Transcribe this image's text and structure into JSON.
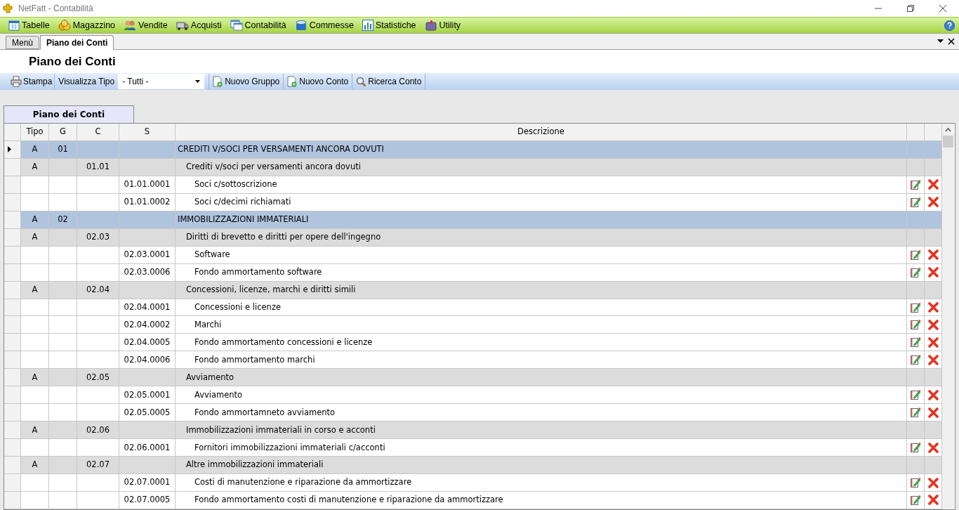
{
  "window": {
    "title": "NetFatt - Contabilità"
  },
  "menu": [
    {
      "label": "Tabelle"
    },
    {
      "label": "Magazzino"
    },
    {
      "label": "Vendite"
    },
    {
      "label": "Acquisti"
    },
    {
      "label": "Contabilità"
    },
    {
      "label": "Commesse"
    },
    {
      "label": "Statistiche"
    },
    {
      "label": "Utility"
    }
  ],
  "tabs": [
    {
      "label": "Menù",
      "selected": false
    },
    {
      "label": "Piano dei Conti",
      "selected": true
    }
  ],
  "page_title": "Piano dei Conti",
  "toolbar": {
    "print": "Stampa",
    "filter_label": "Visualizza Tipo",
    "filter_value": "- Tutti -",
    "new_group": "Nuovo Gruppo",
    "new_account": "Nuovo Conto",
    "search": "Ricerca Conto"
  },
  "grid_tab": "Piano dei Conti",
  "table": {
    "columns": [
      "Tipo",
      "G",
      "C",
      "S",
      "Descrizione"
    ],
    "rows": [
      {
        "kind": "group",
        "selected": true,
        "tipo": "A",
        "g": "01",
        "c": "",
        "s": "",
        "descrizione": "CREDITI V/SOCI PER VERSAMENTI ANCORA DOVUTI"
      },
      {
        "kind": "account",
        "selected": false,
        "tipo": "A",
        "g": "",
        "c": "01.01",
        "s": "",
        "descrizione": "Crediti v/soci per versamenti ancora dovuti"
      },
      {
        "kind": "sub",
        "selected": false,
        "tipo": "",
        "g": "",
        "c": "",
        "s": "01.01.0001",
        "descrizione": "Soci c/sottoscrizione"
      },
      {
        "kind": "sub",
        "selected": false,
        "tipo": "",
        "g": "",
        "c": "",
        "s": "01.01.0002",
        "descrizione": "Soci c/decimi richiamati"
      },
      {
        "kind": "group",
        "selected": false,
        "tipo": "A",
        "g": "02",
        "c": "",
        "s": "",
        "descrizione": "IMMOBILIZZAZIONI IMMATERIALI"
      },
      {
        "kind": "account",
        "selected": false,
        "tipo": "A",
        "g": "",
        "c": "02.03",
        "s": "",
        "descrizione": "Diritti di brevetto e diritti per opere dell'ingegno"
      },
      {
        "kind": "sub",
        "selected": false,
        "tipo": "",
        "g": "",
        "c": "",
        "s": "02.03.0001",
        "descrizione": "Software"
      },
      {
        "kind": "sub",
        "selected": false,
        "tipo": "",
        "g": "",
        "c": "",
        "s": "02.03.0006",
        "descrizione": "Fondo ammortamento software"
      },
      {
        "kind": "account",
        "selected": false,
        "tipo": "A",
        "g": "",
        "c": "02.04",
        "s": "",
        "descrizione": "Concessioni, licenze, marchi e diritti simili"
      },
      {
        "kind": "sub",
        "selected": false,
        "tipo": "",
        "g": "",
        "c": "",
        "s": "02.04.0001",
        "descrizione": "Concessioni e licenze"
      },
      {
        "kind": "sub",
        "selected": false,
        "tipo": "",
        "g": "",
        "c": "",
        "s": "02.04.0002",
        "descrizione": "Marchi"
      },
      {
        "kind": "sub",
        "selected": false,
        "tipo": "",
        "g": "",
        "c": "",
        "s": "02.04.0005",
        "descrizione": "Fondo ammortamento concessioni e licenze"
      },
      {
        "kind": "sub",
        "selected": false,
        "tipo": "",
        "g": "",
        "c": "",
        "s": "02.04.0006",
        "descrizione": "Fondo ammortamento marchi"
      },
      {
        "kind": "account",
        "selected": false,
        "tipo": "A",
        "g": "",
        "c": "02.05",
        "s": "",
        "descrizione": "Avviamento"
      },
      {
        "kind": "sub",
        "selected": false,
        "tipo": "",
        "g": "",
        "c": "",
        "s": "02.05.0001",
        "descrizione": "Avviamento"
      },
      {
        "kind": "sub",
        "selected": false,
        "tipo": "",
        "g": "",
        "c": "",
        "s": "02.05.0005",
        "descrizione": "Fondo ammortamneto avviamento"
      },
      {
        "kind": "account",
        "selected": false,
        "tipo": "A",
        "g": "",
        "c": "02.06",
        "s": "",
        "descrizione": "Immobilizzazioni immateriali in corso e acconti"
      },
      {
        "kind": "sub",
        "selected": false,
        "tipo": "",
        "g": "",
        "c": "",
        "s": "02.06.0001",
        "descrizione": "Fornitori immobilizzazioni immateriali c/acconti"
      },
      {
        "kind": "account",
        "selected": false,
        "tipo": "A",
        "g": "",
        "c": "02.07",
        "s": "",
        "descrizione": "Altre immobilizzazioni immateriali"
      },
      {
        "kind": "sub",
        "selected": false,
        "tipo": "",
        "g": "",
        "c": "",
        "s": "02.07.0001",
        "descrizione": "Costi di manutenzione e riparazione da ammortizzare"
      },
      {
        "kind": "sub",
        "selected": false,
        "tipo": "",
        "g": "",
        "c": "",
        "s": "02.07.0005",
        "descrizione": "Fondo ammortamento costi di manutenzione e riparazione da ammortizzare"
      }
    ]
  }
}
